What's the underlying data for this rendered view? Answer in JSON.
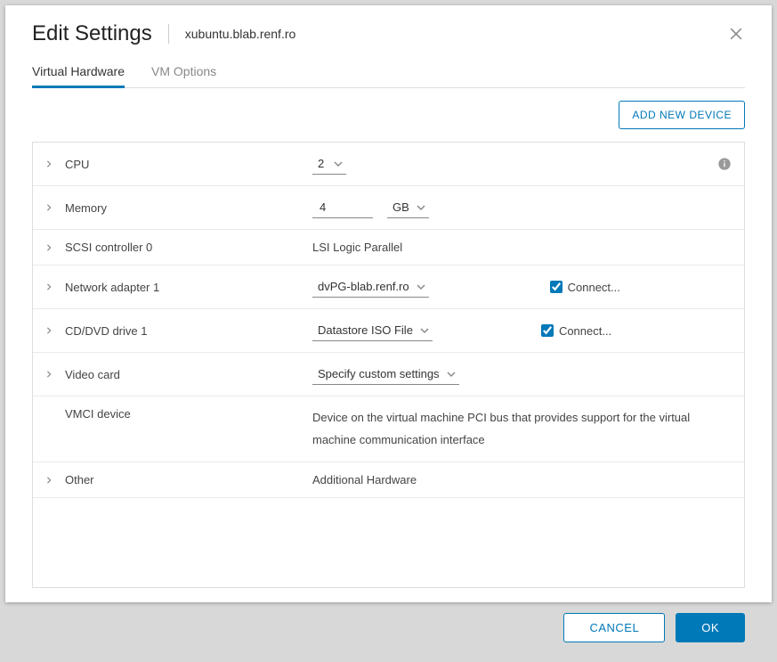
{
  "dialog_title": "Edit Settings",
  "vm_name": "xubuntu.blab.renf.ro",
  "tabs": {
    "virtual_hardware": "Virtual Hardware",
    "vm_options": "VM Options"
  },
  "add_device_label": "ADD NEW DEVICE",
  "rows": {
    "cpu": {
      "label": "CPU",
      "value": "2"
    },
    "memory": {
      "label": "Memory",
      "value": "4",
      "unit": "GB"
    },
    "scsi": {
      "label": "SCSI controller 0",
      "value": "LSI Logic Parallel"
    },
    "net": {
      "label": "Network adapter 1",
      "value": "dvPG-blab.renf.ro",
      "connect": "Connect..."
    },
    "cd": {
      "label": "CD/DVD drive 1",
      "value": "Datastore ISO File",
      "connect": "Connect..."
    },
    "video": {
      "label": "Video card",
      "value": "Specify custom settings"
    },
    "vmci": {
      "label": "VMCI device",
      "desc": "Device on the virtual machine PCI bus that provides support for the virtual machine communication interface"
    },
    "other": {
      "label": "Other",
      "value": "Additional Hardware"
    }
  },
  "footer": {
    "cancel": "CANCEL",
    "ok": "OK"
  }
}
